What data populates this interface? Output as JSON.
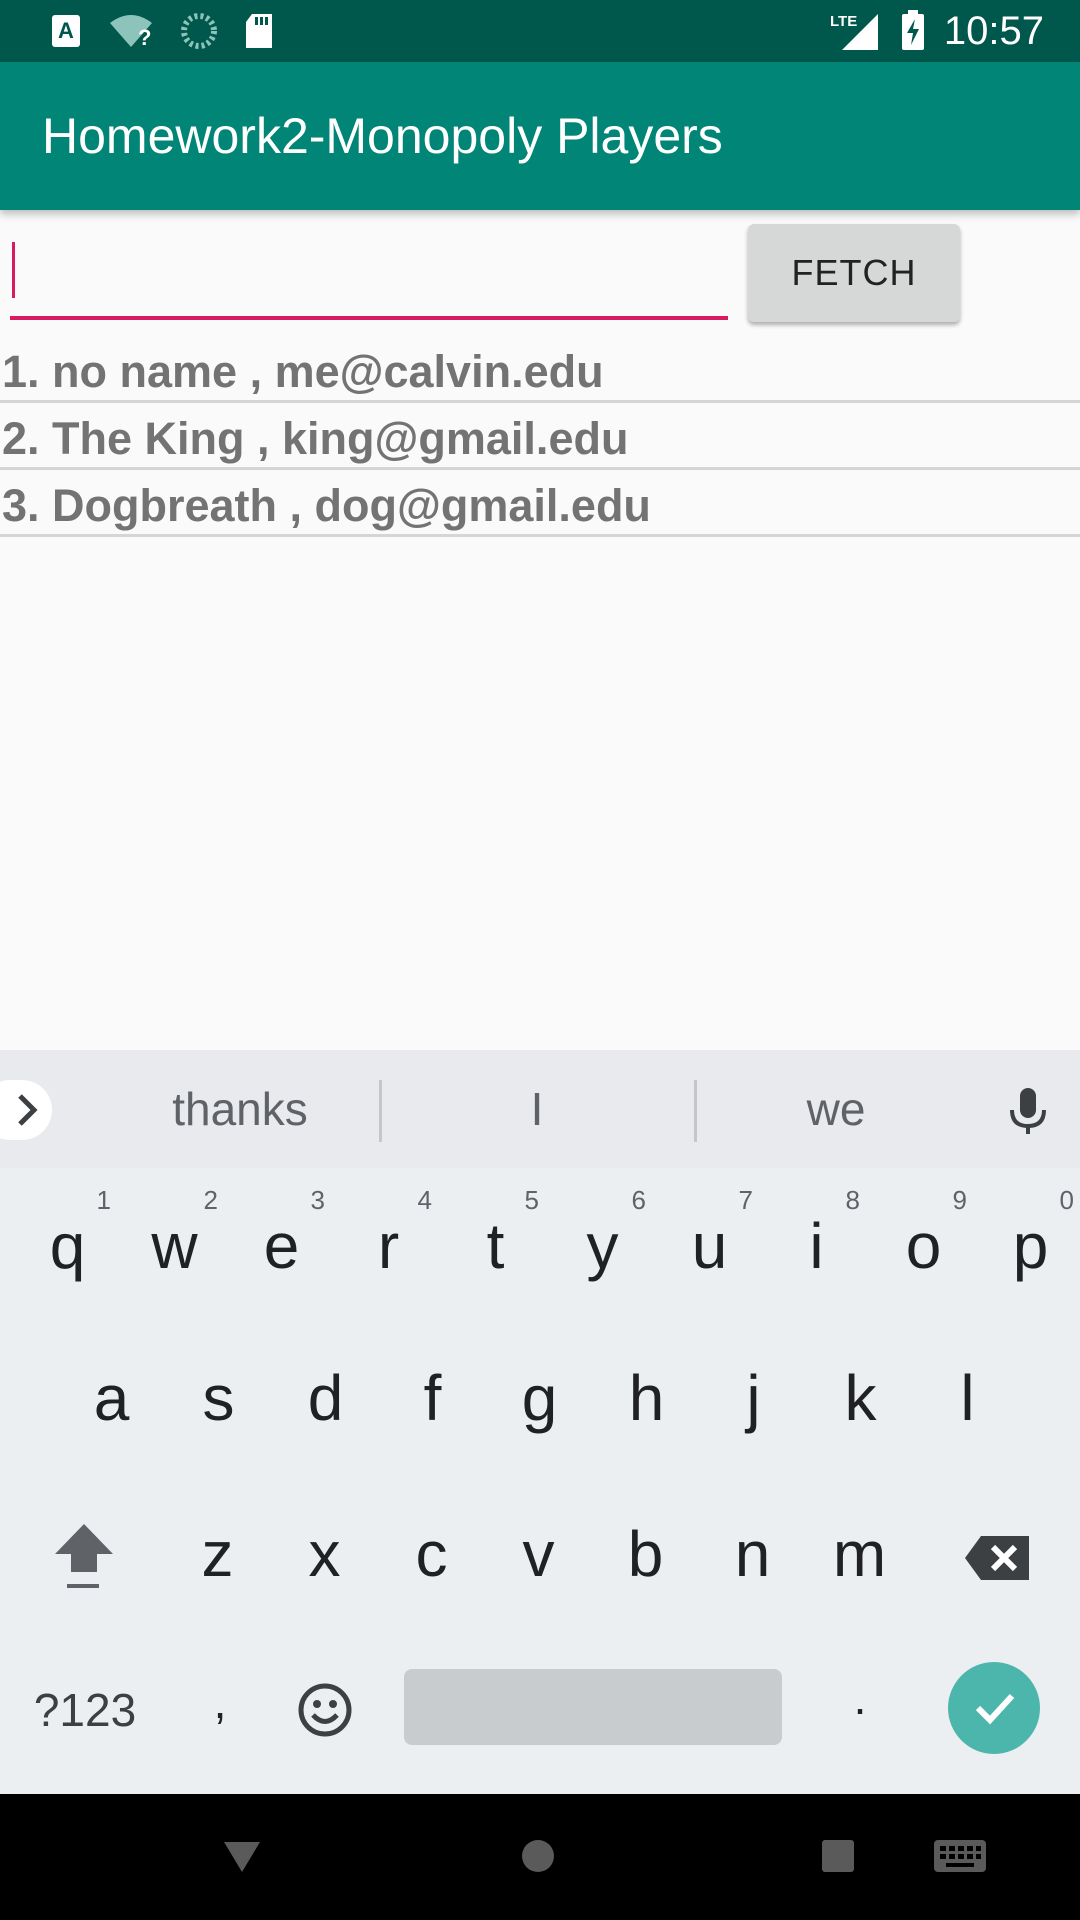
{
  "status_bar": {
    "time": "10:57",
    "network_label": "LTE",
    "icons": [
      "a-notification-icon",
      "wifi-question-icon",
      "loading-icon",
      "sd-card-icon",
      "signal-icon",
      "battery-charging-icon"
    ]
  },
  "app_bar": {
    "title": "Homework2-Monopoly Players"
  },
  "form": {
    "input_value": "",
    "fetch_label": "FETCH"
  },
  "players": [
    {
      "text": "1. no name , me@calvin.edu"
    },
    {
      "text": "2. The King , king@gmail.edu"
    },
    {
      "text": "3. Dogbreath , dog@gmail.edu"
    }
  ],
  "keyboard": {
    "suggestions": [
      "thanks",
      "I",
      "we"
    ],
    "row1": [
      {
        "key": "q",
        "hint": "1"
      },
      {
        "key": "w",
        "hint": "2"
      },
      {
        "key": "e",
        "hint": "3"
      },
      {
        "key": "r",
        "hint": "4"
      },
      {
        "key": "t",
        "hint": "5"
      },
      {
        "key": "y",
        "hint": "6"
      },
      {
        "key": "u",
        "hint": "7"
      },
      {
        "key": "i",
        "hint": "8"
      },
      {
        "key": "o",
        "hint": "9"
      },
      {
        "key": "p",
        "hint": "0"
      }
    ],
    "row2": [
      "a",
      "s",
      "d",
      "f",
      "g",
      "h",
      "j",
      "k",
      "l"
    ],
    "row3": [
      "z",
      "x",
      "c",
      "v",
      "b",
      "n",
      "m"
    ],
    "symbols_label": "?123",
    "comma": ",",
    "period": "."
  },
  "colors": {
    "status_bar": "#00574b",
    "app_bar": "#008577",
    "accent": "#d81b60",
    "done_button": "#4db6ac"
  }
}
